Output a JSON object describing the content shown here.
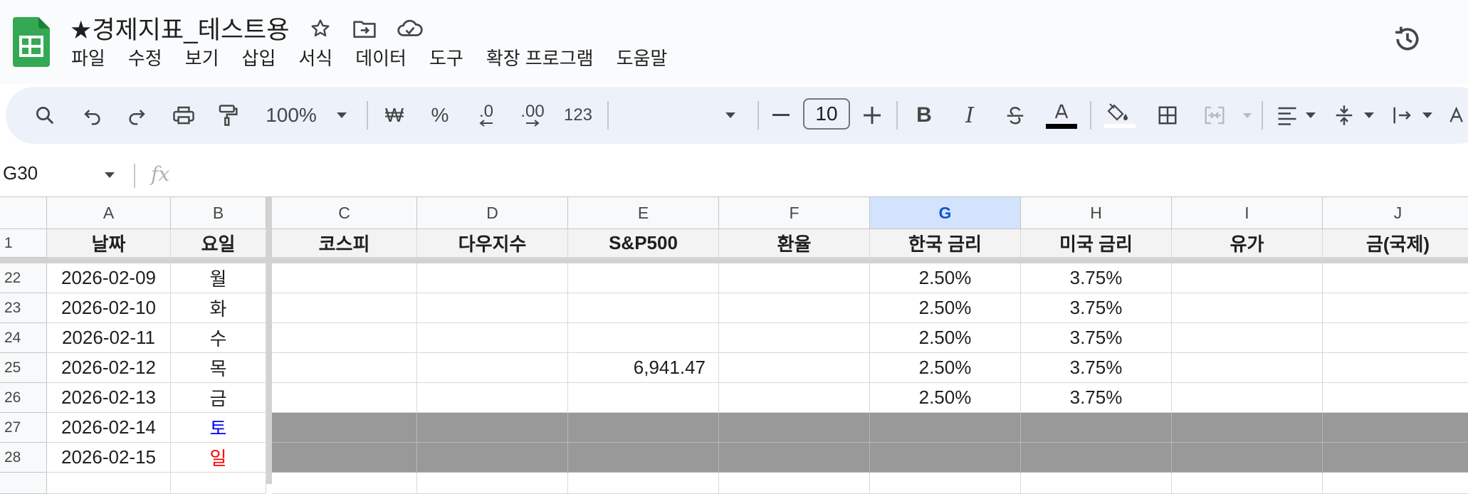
{
  "app": {
    "doc_title": "★경제지표_테스트용",
    "menu": [
      "파일",
      "수정",
      "보기",
      "삽입",
      "서식",
      "데이터",
      "도구",
      "확장 프로그램",
      "도움말"
    ]
  },
  "toolbar": {
    "zoom": "100%",
    "currency": "₩",
    "percent": "%",
    "decrease_decimal": ".0",
    "increase_decimal": ".00",
    "number_format": "123",
    "font_size": "10",
    "minus": "−",
    "plus": "+",
    "bold": "B",
    "italic": "I"
  },
  "formula_bar": {
    "cell_ref": "G30",
    "fx": "fx"
  },
  "sheet": {
    "columns": [
      "A",
      "B",
      "C",
      "D",
      "E",
      "F",
      "G",
      "H",
      "I",
      "J"
    ],
    "selected_column": "G",
    "header_row_number": "1",
    "headers": [
      "날짜",
      "요일",
      "코스피",
      "다우지수",
      "S&P500",
      "환율",
      "한국 금리",
      "미국 금리",
      "유가",
      "금(국제)"
    ],
    "rows": [
      {
        "num": "22",
        "cells": [
          "2026-02-09",
          "월",
          "",
          "",
          "",
          "",
          "2.50%",
          "3.75%",
          "",
          ""
        ],
        "weekend": ""
      },
      {
        "num": "23",
        "cells": [
          "2026-02-10",
          "화",
          "",
          "",
          "",
          "",
          "2.50%",
          "3.75%",
          "",
          ""
        ],
        "weekend": ""
      },
      {
        "num": "24",
        "cells": [
          "2026-02-11",
          "수",
          "",
          "",
          "",
          "",
          "2.50%",
          "3.75%",
          "",
          ""
        ],
        "weekend": ""
      },
      {
        "num": "25",
        "cells": [
          "2026-02-12",
          "목",
          "",
          "",
          "6,941.47",
          "",
          "2.50%",
          "3.75%",
          "",
          ""
        ],
        "weekend": ""
      },
      {
        "num": "26",
        "cells": [
          "2026-02-13",
          "금",
          "",
          "",
          "",
          "",
          "2.50%",
          "3.75%",
          "",
          ""
        ],
        "weekend": ""
      },
      {
        "num": "27",
        "cells": [
          "2026-02-14",
          "토",
          "",
          "",
          "",
          "",
          "",
          "",
          "",
          ""
        ],
        "weekend": "sat"
      },
      {
        "num": "28",
        "cells": [
          "2026-02-15",
          "일",
          "",
          "",
          "",
          "",
          "",
          "",
          "",
          ""
        ],
        "weekend": "sun"
      }
    ]
  },
  "colors": {
    "accent": "#0b57d0",
    "weekend_fill": "#999999",
    "saturday_text": "#0000ff",
    "sunday_text": "#ff0000"
  }
}
